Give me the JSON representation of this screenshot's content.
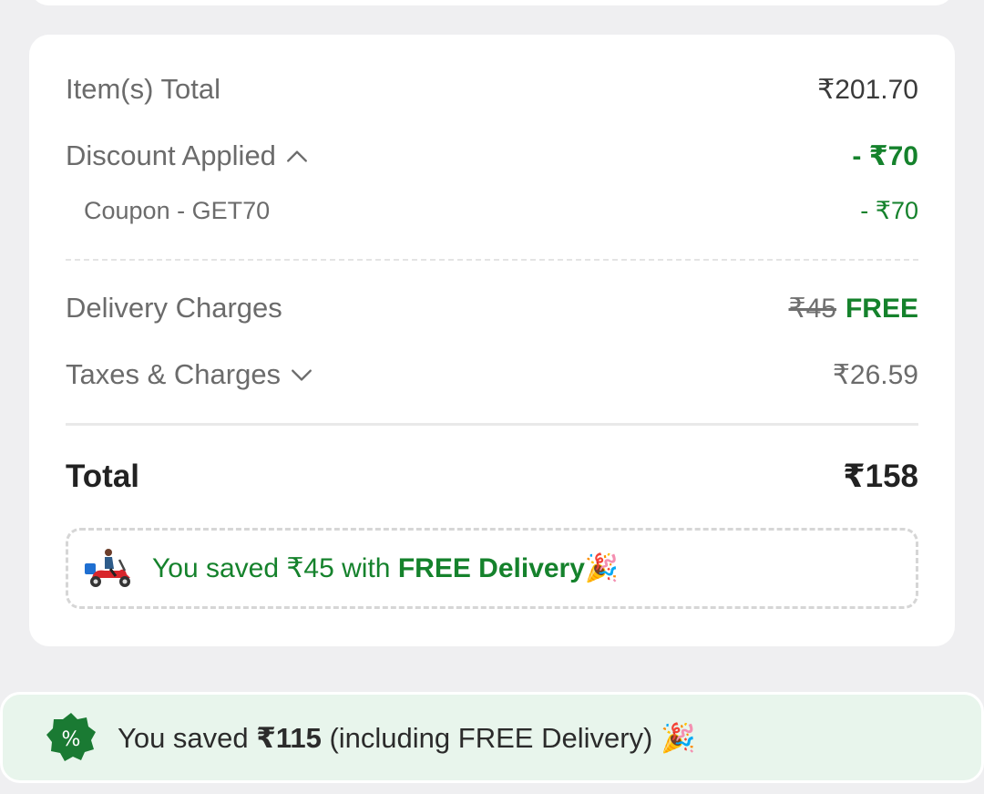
{
  "bill": {
    "items_total_label": "Item(s) Total",
    "items_total_value": "₹201.70",
    "discount_label": "Discount Applied",
    "discount_value": "- ₹70",
    "coupon_label": "Coupon - GET70",
    "coupon_value": "- ₹70",
    "delivery_label": "Delivery Charges",
    "delivery_original": "₹45",
    "delivery_value": "FREE",
    "taxes_label": "Taxes & Charges",
    "taxes_value": "₹26.59",
    "total_label": "Total",
    "total_value": "₹158"
  },
  "delivery_saving": {
    "prefix": "You saved ₹45 with ",
    "highlight": "FREE Delivery",
    "emoji": "🎉"
  },
  "savings_bar": {
    "prefix": "You saved ",
    "amount": "₹115",
    "suffix": " (including FREE Delivery) ",
    "emoji": "🎉",
    "badge_symbol": "%"
  },
  "colors": {
    "accent_green": "#15822c",
    "badge_green": "#1a7a33",
    "savings_bar_bg": "#e8f5ec",
    "page_bg": "#efeff1"
  },
  "icons": {
    "discount_toggle": "chevron-up-icon",
    "taxes_toggle": "chevron-down-icon",
    "delivery": "delivery-scooter-icon",
    "badge": "percent-badge-icon",
    "celebration": "party-popper-icon"
  }
}
